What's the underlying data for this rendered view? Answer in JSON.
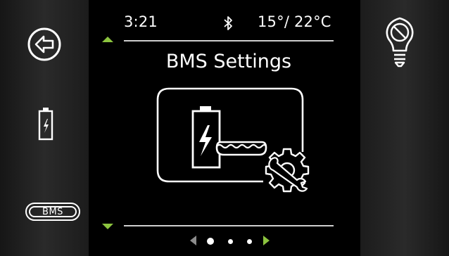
{
  "status_bar": {
    "time": "3:21",
    "bluetooth_icon": "bluetooth-icon",
    "temperature": "15°/ 22°C"
  },
  "screen": {
    "title": "BMS Settings",
    "illustration_icon": "battery-bms-settings-icon"
  },
  "left_rail": {
    "back_icon": "back-arrow-icon",
    "battery_icon": "battery-charging-icon",
    "bms_label": "BMS"
  },
  "right_rail": {
    "light_icon": "light-off-icon"
  },
  "pager": {
    "pages": 3,
    "current": 1
  },
  "colors": {
    "accent": "#8cc43f",
    "foreground": "#ffffff",
    "background": "#000000",
    "rail": "#2a2a2a"
  }
}
